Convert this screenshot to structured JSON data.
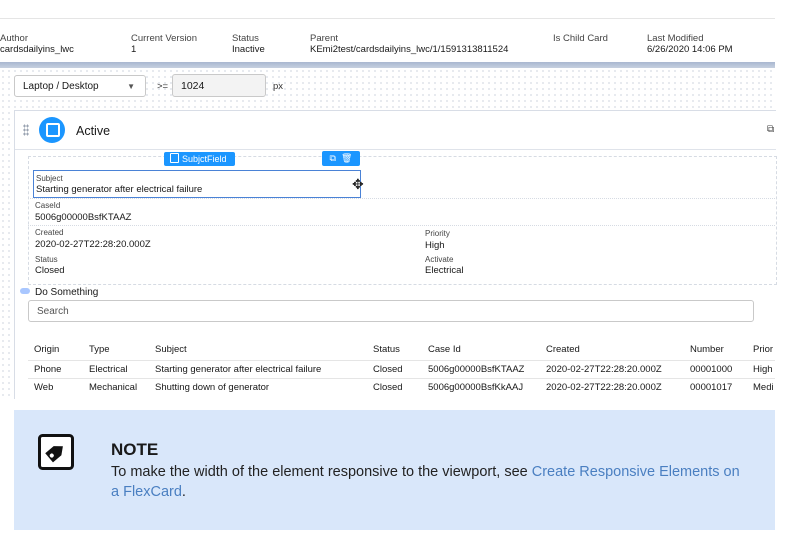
{
  "header": {
    "fields": [
      {
        "label": "Author",
        "value": "cardsdailyins_lwc"
      },
      {
        "label": "Current Version",
        "value": "1"
      },
      {
        "label": "Status",
        "value": "Inactive"
      },
      {
        "label": "Parent",
        "value": "KEmi2test/cardsdailyins_lwc/1/1591313811524"
      },
      {
        "label": "Is Child Card",
        "value": ""
      },
      {
        "label": "Last Modified",
        "value": "6/26/2020 14:06 PM"
      }
    ]
  },
  "toolbar": {
    "viewport_value": "Laptop / Desktop",
    "operator": ">=",
    "width_value": "1024",
    "unit": "px"
  },
  "card": {
    "state_title": "Active",
    "field_tag": "SubjctField",
    "subject_label": "Subject",
    "subject_value": "Starting generator after electrical failure",
    "fields": {
      "caseid_label": "CaseId",
      "caseid_value": "5006g00000BsfKTAAZ",
      "created_label": "Created",
      "created_value": "2020-02-27T22:28:20.000Z",
      "status_label": "Status",
      "status_value": "Closed",
      "priority_label": "Priority",
      "priority_value": "High",
      "activate_label": "Activate",
      "activate_value": "Electrical"
    },
    "action_label": "Do Something",
    "search_placeholder": "Search"
  },
  "table": {
    "headers": [
      "Origin",
      "Type",
      "Subject",
      "Status",
      "Case Id",
      "Created",
      "Number",
      "Prior"
    ],
    "rows": [
      [
        "Phone",
        "Electrical",
        "Starting generator after electrical failure",
        "Closed",
        "5006g00000BsfKTAAZ",
        "2020-02-27T22:28:20.000Z",
        "00001000",
        "High"
      ],
      [
        "Web",
        "Mechanical",
        "Shutting down of generator",
        "Closed",
        "5006g00000BsfKkAAJ",
        "2020-02-27T22:28:20.000Z",
        "00001017",
        "Medi"
      ]
    ]
  },
  "note": {
    "title": "NOTE",
    "text_before": "To make the width of the element responsive to the viewport, see ",
    "link_text": "Create Responsive Elements on a FlexCard",
    "text_after": "."
  },
  "colors": {
    "accent": "#1b96ff",
    "note_bg": "#d9e7fa",
    "link": "#4a7fc1"
  }
}
